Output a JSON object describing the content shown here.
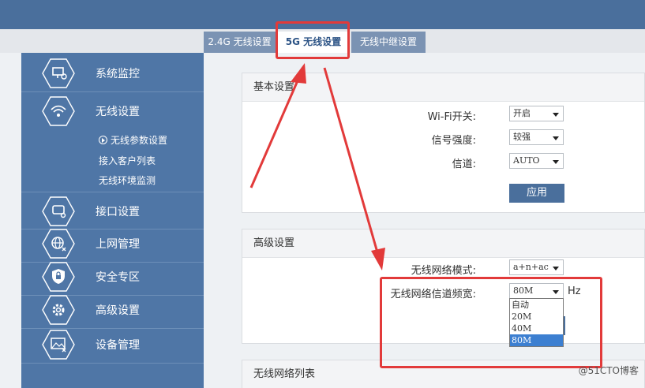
{
  "tabs": [
    {
      "label": "2.4G 无线设置"
    },
    {
      "label": "5G 无线设置"
    },
    {
      "label": "无线中继设置"
    }
  ],
  "sidebar": {
    "items": [
      {
        "label": "系统监控",
        "icon": "monitor-icon"
      },
      {
        "label": "无线设置",
        "icon": "wifi-icon"
      },
      {
        "label": "接口设置",
        "icon": "interface-icon"
      },
      {
        "label": "上网管理",
        "icon": "globe-icon"
      },
      {
        "label": "安全专区",
        "icon": "lock-icon"
      },
      {
        "label": "高级设置",
        "icon": "gear-icon"
      },
      {
        "label": "设备管理",
        "icon": "device-icon"
      }
    ],
    "sub_items": [
      {
        "label": "无线参数设置"
      },
      {
        "label": "接入客户列表"
      },
      {
        "label": "无线环境监测"
      }
    ]
  },
  "basic": {
    "title": "基本设置",
    "wifi_label": "Wi-Fi开关:",
    "wifi_value": "开启",
    "strength_label": "信号强度:",
    "strength_value": "较强",
    "channel_label": "信道:",
    "channel_value": "AUTO",
    "apply_label": "应用"
  },
  "advanced": {
    "title": "高级设置",
    "mode_label": "无线网络模式:",
    "mode_value": "a+n+ac",
    "bandwidth_label": "无线网络信道频宽:",
    "bandwidth_value": "80M",
    "unit": "Hz",
    "options": [
      "自动",
      "20M",
      "40M",
      "80M"
    ]
  },
  "list": {
    "title": "无线网络列表"
  },
  "watermark": "@51CTO博客",
  "colors": {
    "accent": "#4a6f9c",
    "annotation": "#e23a3a"
  }
}
